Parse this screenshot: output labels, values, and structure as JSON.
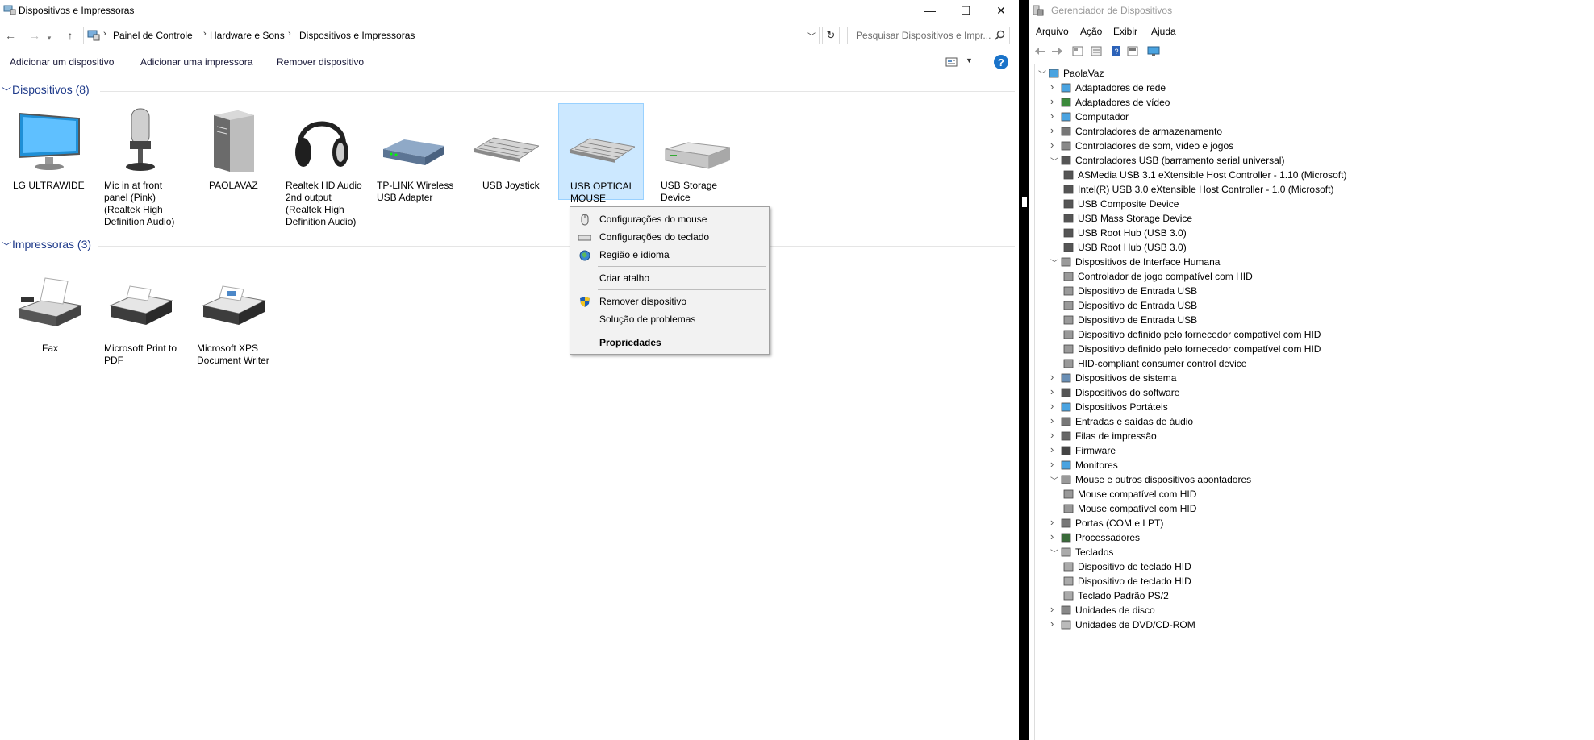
{
  "left_window": {
    "title": "Dispositivos e Impressoras",
    "controls": {
      "minimize": "—",
      "maximize": "☐",
      "close": "✕"
    },
    "nav": {
      "back": "←",
      "forward": "→",
      "up": "↑"
    },
    "breadcrumb": [
      "Painel de Controle",
      "Hardware e Sons",
      "Dispositivos e Impressoras"
    ],
    "search_placeholder": "Pesquisar Dispositivos e Impr...",
    "toolbar": {
      "add_device": "Adicionar um dispositivo",
      "add_printer": "Adicionar uma impressora",
      "remove_device": "Remover dispositivo"
    },
    "groups": {
      "devices_title": "Dispositivos (8)",
      "printers_title": "Impressoras (3)"
    },
    "devices": [
      {
        "label": "LG ULTRAWIDE",
        "icon": "monitor-icon"
      },
      {
        "label": "Mic in at front panel (Pink) (Realtek High Definition Audio)",
        "icon": "microphone-icon"
      },
      {
        "label": "PAOLAVAZ",
        "icon": "computer-tower-icon"
      },
      {
        "label": "Realtek HD Audio 2nd output (Realtek High Definition Audio)",
        "icon": "headphones-icon"
      },
      {
        "label": "TP-LINK Wireless USB Adapter",
        "icon": "network-adapter-icon"
      },
      {
        "label": "USB Joystick",
        "icon": "keyboard-icon"
      },
      {
        "label": "USB OPTICAL MOUSE",
        "icon": "keyboard-icon",
        "selected": true
      },
      {
        "label": "USB Storage Device",
        "icon": "storage-drive-icon"
      }
    ],
    "printers": [
      {
        "label": "Fax",
        "icon": "fax-icon"
      },
      {
        "label": "Microsoft Print to PDF",
        "icon": "printer-icon"
      },
      {
        "label": "Microsoft XPS Document Writer",
        "icon": "printer-icon"
      }
    ],
    "context_menu": {
      "mouse_settings": "Configurações do mouse",
      "keyboard_settings": "Configurações do teclado",
      "region_language": "Região e idioma",
      "create_shortcut": "Criar atalho",
      "remove_device": "Remover dispositivo",
      "troubleshoot": "Solução de problemas",
      "properties": "Propriedades"
    }
  },
  "right_window": {
    "title": "Gerenciador de Dispositivos",
    "menu": [
      "Arquivo",
      "Ação",
      "Exibir",
      "Ajuda"
    ],
    "tree": {
      "root": "PaolaVaz",
      "nodes": [
        {
          "label": "Adaptadores de rede",
          "level": 1,
          "expanded": false,
          "icon": "network-icon"
        },
        {
          "label": "Adaptadores de vídeo",
          "level": 1,
          "expanded": false,
          "icon": "display-adapter-icon"
        },
        {
          "label": "Computador",
          "level": 1,
          "expanded": false,
          "icon": "computer-icon"
        },
        {
          "label": "Controladores de armazenamento",
          "level": 1,
          "expanded": false,
          "icon": "storage-controller-icon"
        },
        {
          "label": "Controladores de som, vídeo e jogos",
          "level": 1,
          "expanded": false,
          "icon": "sound-icon"
        },
        {
          "label": "Controladores USB (barramento serial universal)",
          "level": 1,
          "expanded": true,
          "icon": "usb-icon"
        },
        {
          "label": "ASMedia USB 3.1 eXtensible Host Controller - 1.10 (Microsoft)",
          "level": 2,
          "icon": "usb-icon"
        },
        {
          "label": "Intel(R) USB 3.0 eXtensible Host Controller - 1.0 (Microsoft)",
          "level": 2,
          "icon": "usb-icon"
        },
        {
          "label": "USB Composite Device",
          "level": 2,
          "icon": "usb-icon"
        },
        {
          "label": "USB Mass Storage Device",
          "level": 2,
          "icon": "usb-icon"
        },
        {
          "label": "USB Root Hub (USB 3.0)",
          "level": 2,
          "icon": "usb-icon"
        },
        {
          "label": "USB Root Hub (USB 3.0)",
          "level": 2,
          "icon": "usb-icon"
        },
        {
          "label": "Dispositivos de Interface Humana",
          "level": 1,
          "expanded": true,
          "icon": "hid-icon"
        },
        {
          "label": "Controlador de jogo compatível com HID",
          "level": 2,
          "icon": "hid-icon"
        },
        {
          "label": "Dispositivo de Entrada USB",
          "level": 2,
          "icon": "hid-icon"
        },
        {
          "label": "Dispositivo de Entrada USB",
          "level": 2,
          "icon": "hid-icon"
        },
        {
          "label": "Dispositivo de Entrada USB",
          "level": 2,
          "icon": "hid-icon"
        },
        {
          "label": "Dispositivo definido pelo fornecedor compatível com HID",
          "level": 2,
          "icon": "hid-icon"
        },
        {
          "label": "Dispositivo definido pelo fornecedor compatível com HID",
          "level": 2,
          "icon": "hid-icon"
        },
        {
          "label": "HID-compliant consumer control device",
          "level": 2,
          "icon": "hid-icon"
        },
        {
          "label": "Dispositivos de sistema",
          "level": 1,
          "expanded": false,
          "icon": "system-icon"
        },
        {
          "label": "Dispositivos do software",
          "level": 1,
          "expanded": false,
          "icon": "software-icon"
        },
        {
          "label": "Dispositivos Portáteis",
          "level": 1,
          "expanded": false,
          "icon": "portable-icon"
        },
        {
          "label": "Entradas e saídas de áudio",
          "level": 1,
          "expanded": false,
          "icon": "speaker-icon"
        },
        {
          "label": "Filas de impressão",
          "level": 1,
          "expanded": false,
          "icon": "print-queue-icon"
        },
        {
          "label": "Firmware",
          "level": 1,
          "expanded": false,
          "icon": "firmware-icon"
        },
        {
          "label": "Monitores",
          "level": 1,
          "expanded": false,
          "icon": "monitor-icon"
        },
        {
          "label": "Mouse e outros dispositivos apontadores",
          "level": 1,
          "expanded": true,
          "icon": "mouse-icon"
        },
        {
          "label": "Mouse compatível com HID",
          "level": 2,
          "icon": "mouse-icon"
        },
        {
          "label": "Mouse compatível com HID",
          "level": 2,
          "icon": "mouse-icon"
        },
        {
          "label": "Portas (COM e LPT)",
          "level": 1,
          "expanded": false,
          "icon": "port-icon"
        },
        {
          "label": "Processadores",
          "level": 1,
          "expanded": false,
          "icon": "processor-icon"
        },
        {
          "label": "Teclados",
          "level": 1,
          "expanded": true,
          "icon": "keyboard-icon"
        },
        {
          "label": "Dispositivo de teclado HID",
          "level": 2,
          "icon": "keyboard-icon"
        },
        {
          "label": "Dispositivo de teclado HID",
          "level": 2,
          "icon": "keyboard-icon"
        },
        {
          "label": "Teclado Padrão PS/2",
          "level": 2,
          "icon": "keyboard-icon"
        },
        {
          "label": "Unidades de disco",
          "level": 1,
          "expanded": false,
          "icon": "disk-icon"
        },
        {
          "label": "Unidades de DVD/CD-ROM",
          "level": 1,
          "expanded": false,
          "icon": "dvd-icon"
        }
      ]
    }
  }
}
